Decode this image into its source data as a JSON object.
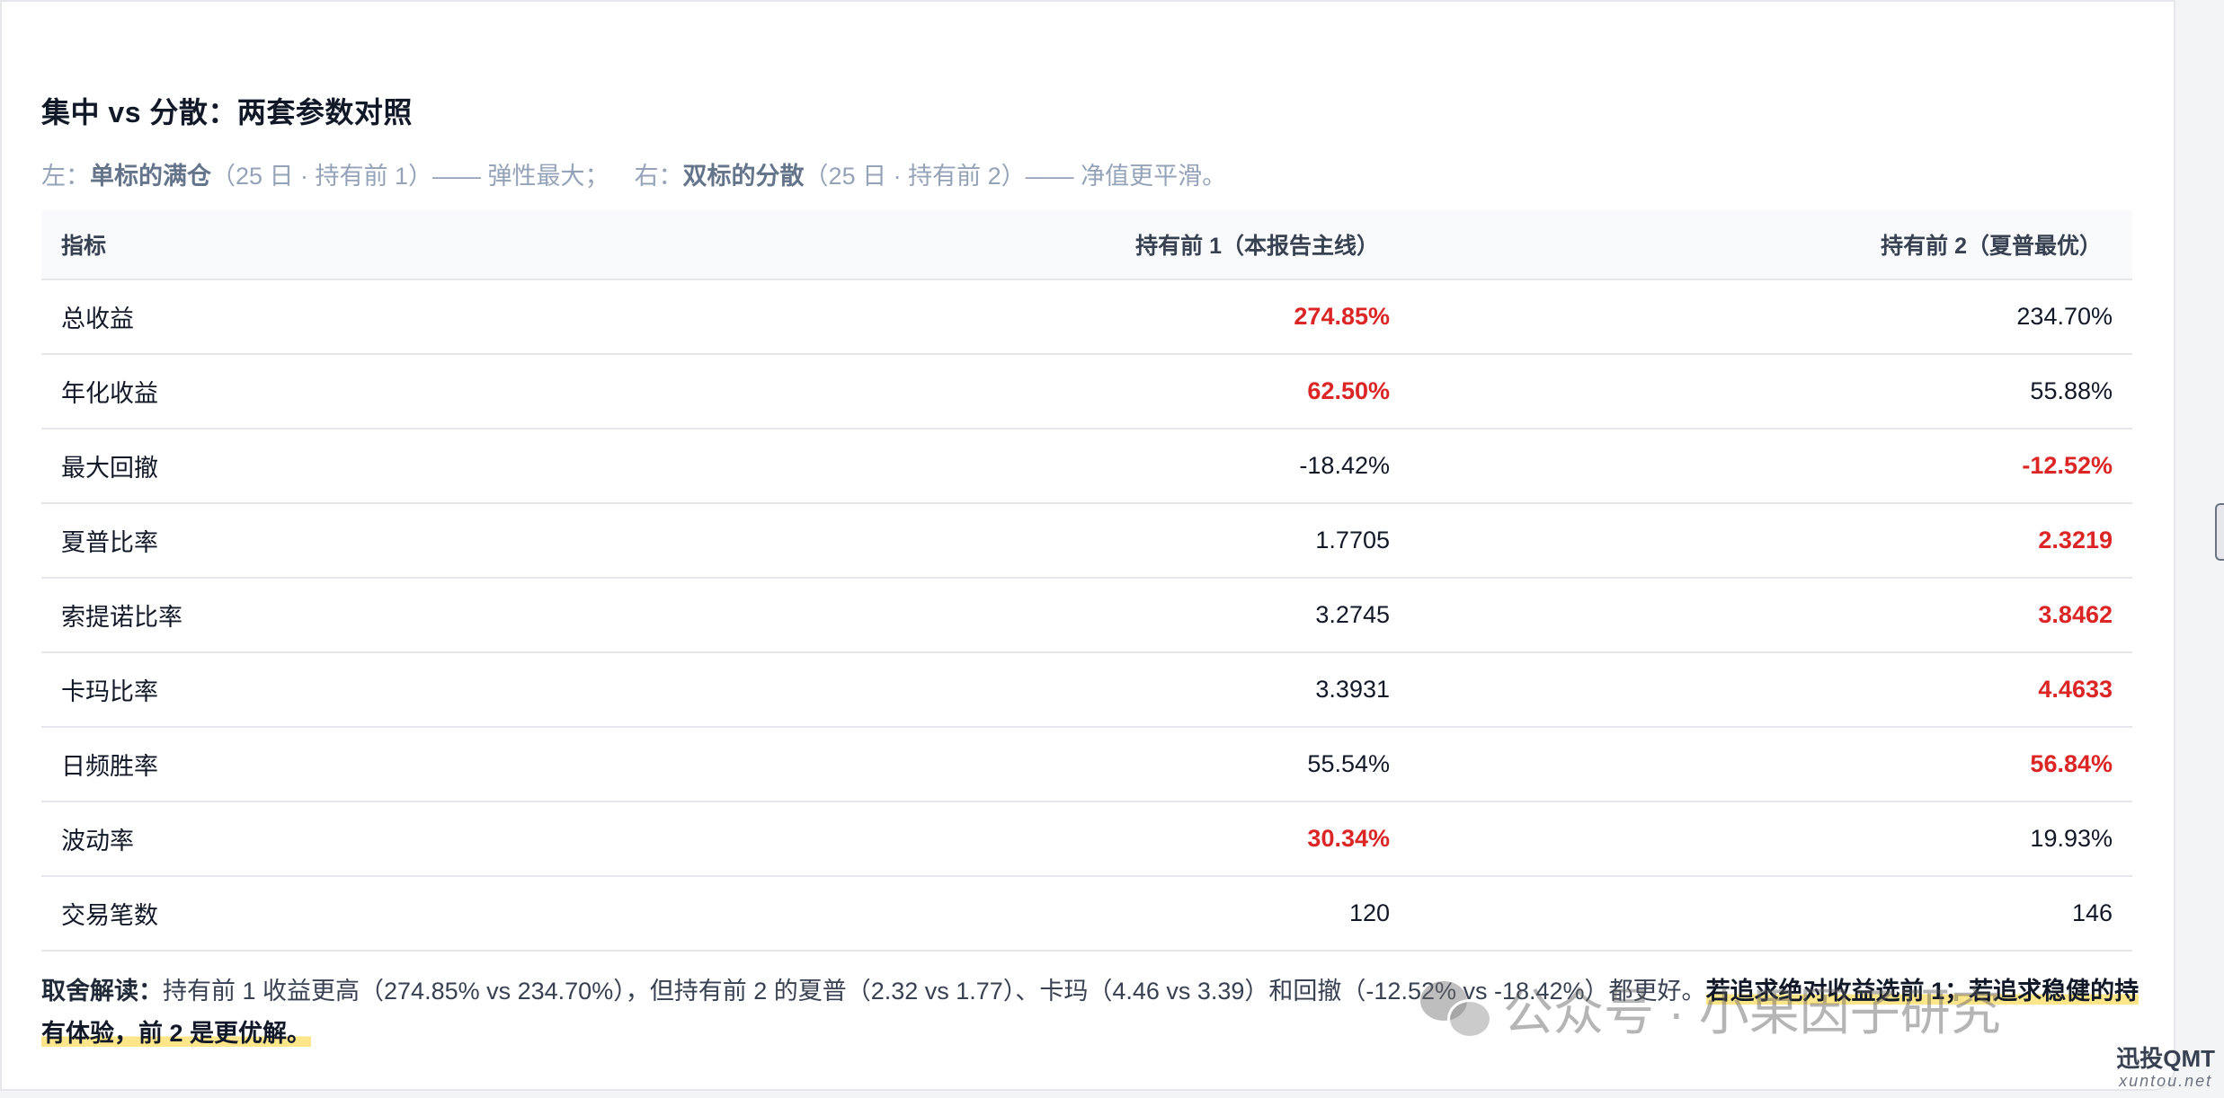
{
  "title": "集中 vs 分散：两套参数对照",
  "subtitle": {
    "left_prefix": "左：",
    "left_bold": "单标的满仓",
    "left_rest": "（25 日 · 持有前 1）—— 弹性最大；",
    "right_prefix": "右：",
    "right_bold": "双标的分散",
    "right_rest": "（25 日 · 持有前 2）—— 净值更平滑。"
  },
  "table": {
    "headers": [
      "指标",
      "持有前 1（本报告主线）",
      "持有前 2（夏普最优）"
    ],
    "rows": [
      {
        "label": "总收益",
        "v1": "274.85%",
        "v2": "234.70%",
        "better": 1
      },
      {
        "label": "年化收益",
        "v1": "62.50%",
        "v2": "55.88%",
        "better": 1
      },
      {
        "label": "最大回撤",
        "v1": "-18.42%",
        "v2": "-12.52%",
        "better": 2
      },
      {
        "label": "夏普比率",
        "v1": "1.7705",
        "v2": "2.3219",
        "better": 2
      },
      {
        "label": "索提诺比率",
        "v1": "3.2745",
        "v2": "3.8462",
        "better": 2
      },
      {
        "label": "卡玛比率",
        "v1": "3.3931",
        "v2": "4.4633",
        "better": 2
      },
      {
        "label": "日频胜率",
        "v1": "55.54%",
        "v2": "56.84%",
        "better": 2
      },
      {
        "label": "波动率",
        "v1": "30.34%",
        "v2": "19.93%",
        "better": 1
      },
      {
        "label": "交易笔数",
        "v1": "120",
        "v2": "146",
        "better": 0
      }
    ]
  },
  "note": {
    "lead": "取舍解读：",
    "body": "持有前 1 收益更高（274.85% vs 234.70%），但持有前 2 的夏普（2.32 vs 1.77）、卡玛（4.46 vs 3.39）和回撤（-12.52% vs -18.42%）都更好。",
    "highlight": "若追求绝对收益选前 1；若追求稳健的持有体验，前 2 是更优解。"
  },
  "watermark": "公众号 · 小果因子研究",
  "brand": {
    "name": "迅投QMT",
    "url": "xuntou.net"
  },
  "colors": {
    "highlight": "#dc2626",
    "mark": "#fde68a"
  }
}
